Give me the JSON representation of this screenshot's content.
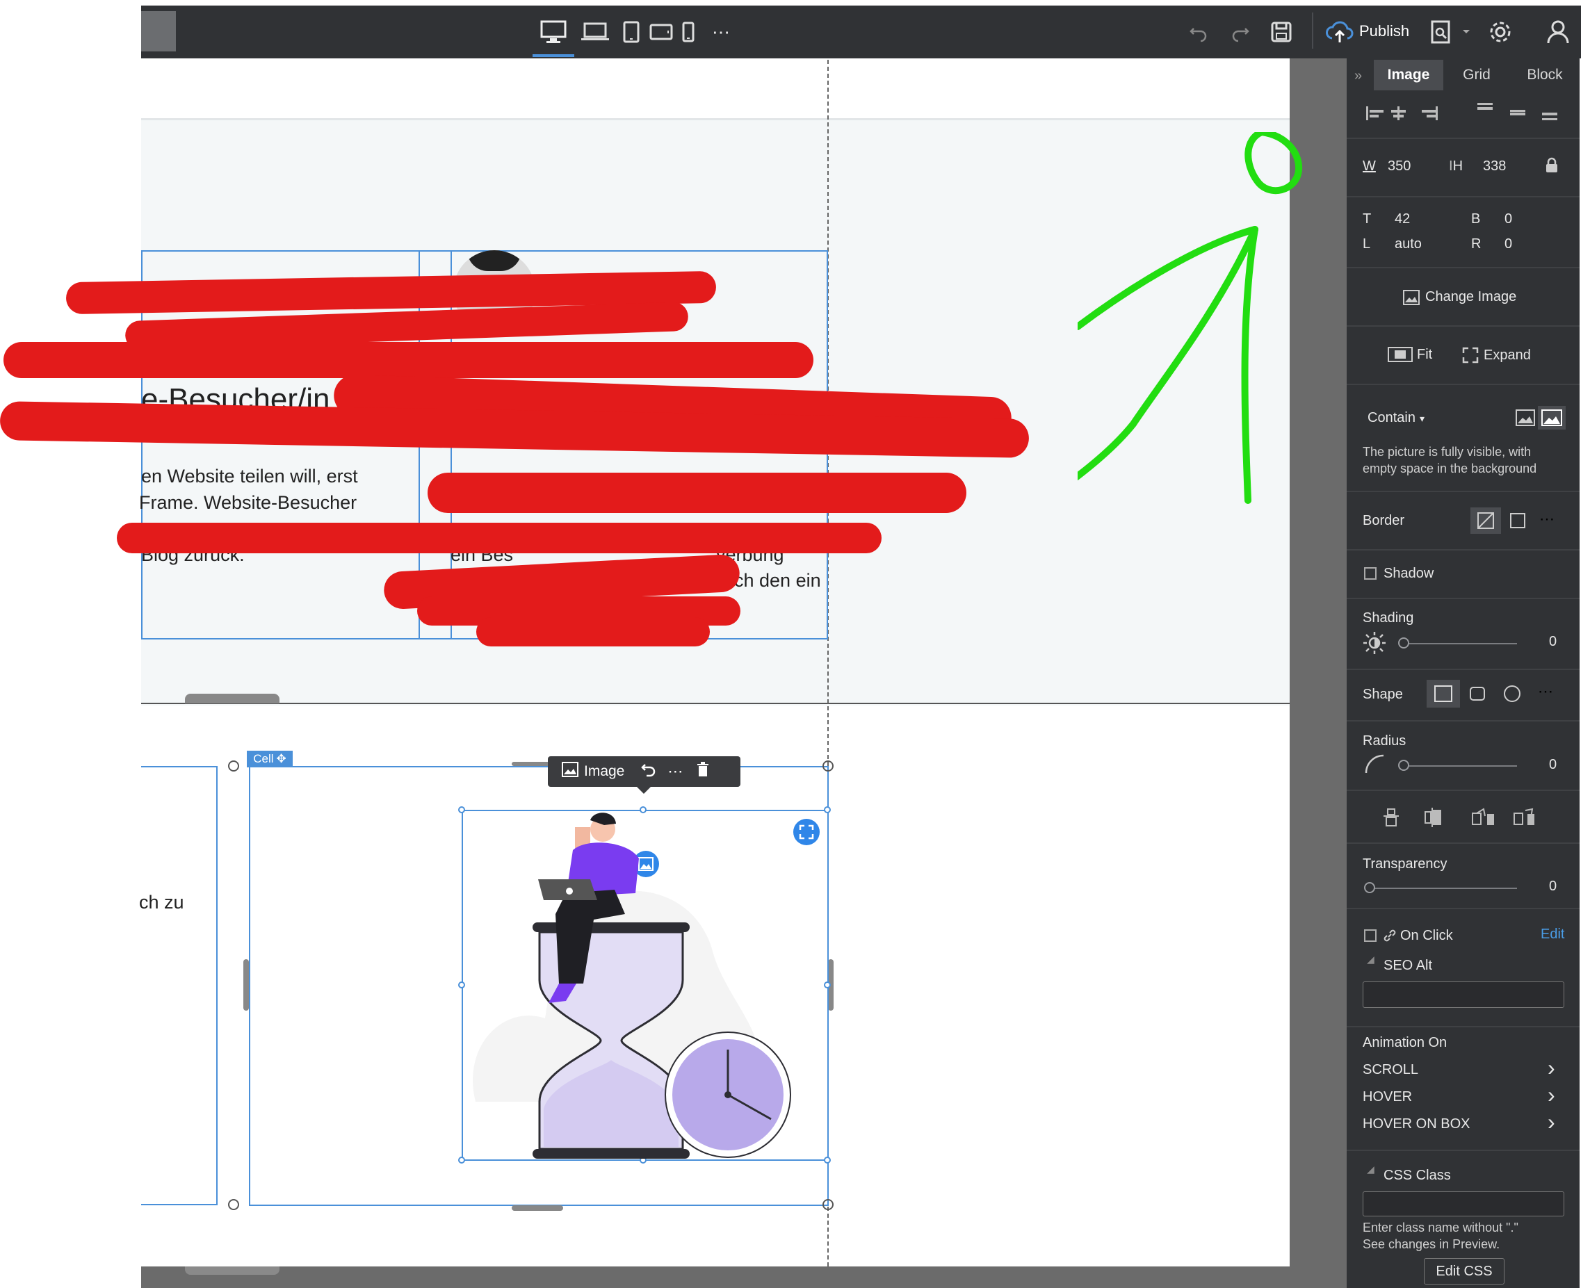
{
  "topbar": {
    "publish_label": "Publish",
    "more_label": "⋯"
  },
  "canvas": {
    "heading_fragment": "e-Besucher/in",
    "lines_left": [
      "en Website teilen will, erst",
      "Frame. Website-Besucher",
      "Blog zurück."
    ],
    "lines_right": [
      "ein Bes",
      "verbung",
      "ich den ein"
    ],
    "side_fragment": "ch zu",
    "cell_tag": "Cell",
    "image_toolbar_label": "Image"
  },
  "panel": {
    "tabs": [
      "Image",
      "Grid",
      "Block"
    ],
    "w_label": "W",
    "w_value": "350",
    "h_label": "H",
    "h_value": "338",
    "t_label": "T",
    "t_value": "42",
    "l_label": "L",
    "l_value": "auto",
    "b_label": "B",
    "b_value": "0",
    "r_label": "R",
    "r_value": "0",
    "change_image": "Change Image",
    "fit": "Fit",
    "expand": "Expand",
    "contain": "Contain",
    "contain_desc_1": "The picture is fully visible, with",
    "contain_desc_2": "empty space in the background",
    "border": "Border",
    "shadow": "Shadow",
    "shading": "Shading",
    "shading_value": "0",
    "shape": "Shape",
    "radius": "Radius",
    "radius_value": "0",
    "transparency": "Transparency",
    "transparency_value": "0",
    "on_click": "On Click",
    "edit": "Edit",
    "seo_alt": "SEO Alt",
    "animation_on": "Animation On",
    "scroll": "SCROLL",
    "hover": "HOVER",
    "hover_on_box": "HOVER ON BOX",
    "css_class": "CSS Class",
    "css_hint_1": "Enter class name without \".\"",
    "css_hint_2": "See changes in Preview.",
    "edit_css": "Edit CSS"
  },
  "colors": {
    "topbar": "#303235",
    "panel": "#303235",
    "accent": "#4a90d9",
    "annotation_green": "#22dd11",
    "redaction_red": "#e31b1b"
  }
}
